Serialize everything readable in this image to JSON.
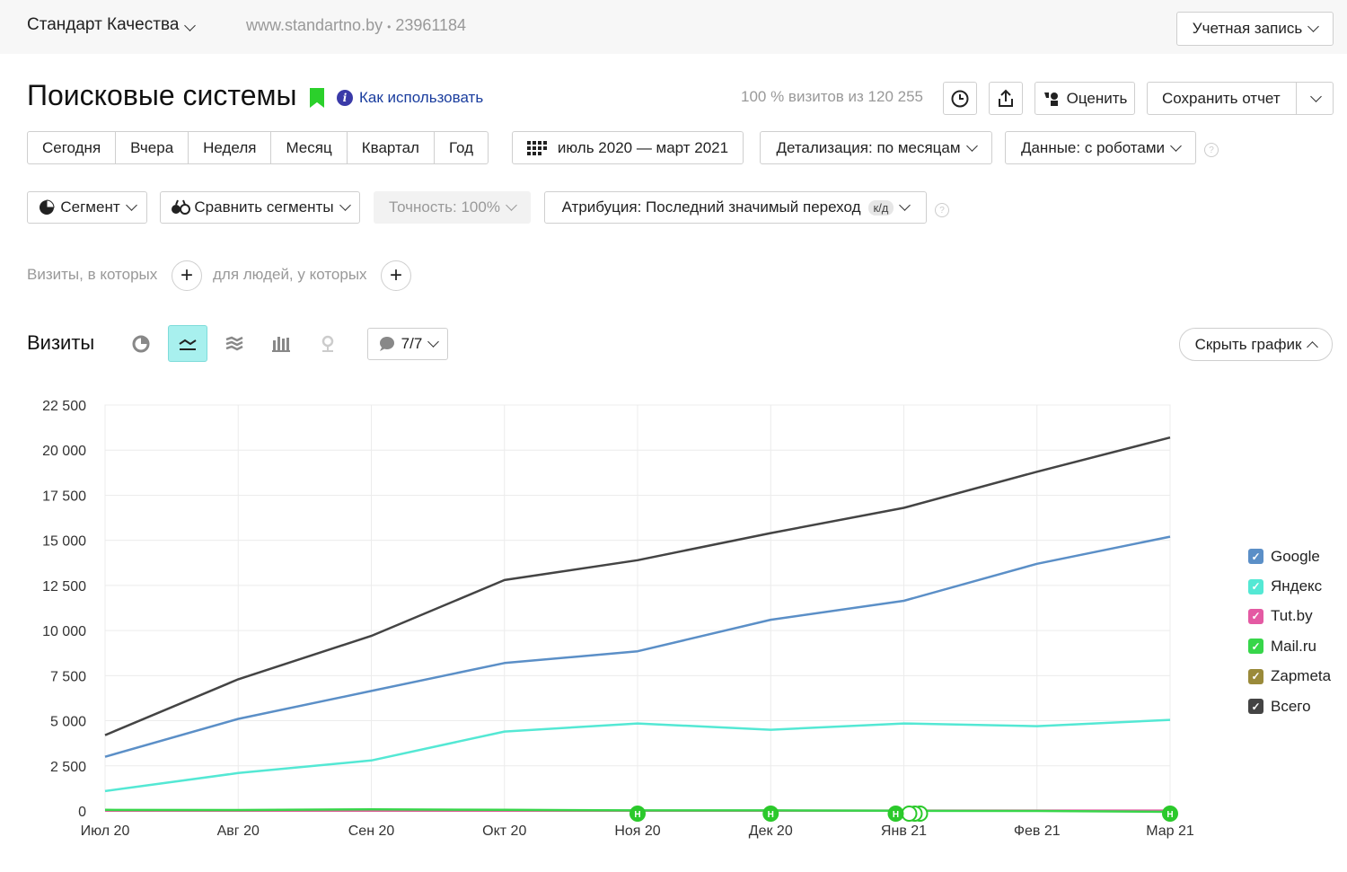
{
  "header": {
    "site_name": "Стандарт Качества",
    "site_url": "www.standartno.by",
    "counter_sep": "•",
    "counter_id": "23961184",
    "account_label": "Учетная запись"
  },
  "report": {
    "title": "Поисковые системы",
    "howto_label": "Как использовать",
    "visits_share": "100 % визитов из 120 255",
    "rate_label": "Оценить",
    "save_label": "Сохранить отчет"
  },
  "periods": [
    "Сегодня",
    "Вчера",
    "Неделя",
    "Месяц",
    "Квартал",
    "Год"
  ],
  "date_range": "июль 2020 — март 2021",
  "detail_label": "Детализация: по месяцам",
  "data_label": "Данные: с роботами",
  "segment_label": "Сегмент",
  "compare_label": "Сравнить сегменты",
  "accuracy_label": "Точность: 100%",
  "attribution_label": "Атрибуция: Последний значимый переход",
  "attribution_badge": "к/д",
  "filters": {
    "visits_label": "Визиты, в которых",
    "people_label": "для людей, у которых"
  },
  "graph_section": {
    "title": "Визиты",
    "series_count": "7/7",
    "hide_label": "Скрыть график"
  },
  "colors": {
    "Google": "#5b8fc7",
    "Яндекс": "#54e8d4",
    "Tut.by": "#e45aa3",
    "Mail.ru": "#37d64a",
    "Zapmeta": "#9a8a3a",
    "Всего": "#444444"
  },
  "chart_data": {
    "type": "line",
    "categories": [
      "Июл 20",
      "Авг 20",
      "Сен 20",
      "Окт 20",
      "Ноя 20",
      "Дек 20",
      "Янв 21",
      "Фев 21",
      "Мар 21"
    ],
    "ylim": [
      0,
      22500
    ],
    "yticks": [
      "0",
      "2 500",
      "5 000",
      "7 500",
      "10 000",
      "12 500",
      "15 000",
      "17 500",
      "20 000",
      "22 500"
    ],
    "grid": true,
    "legend_position": "right",
    "series": [
      {
        "name": "Google",
        "values": [
          3000,
          5100,
          6650,
          8200,
          8850,
          10600,
          11650,
          13700,
          15200
        ]
      },
      {
        "name": "Яндекс",
        "values": [
          1100,
          2100,
          2800,
          4400,
          4850,
          4500,
          4850,
          4700,
          5050
        ]
      },
      {
        "name": "Tut.by",
        "values": [
          20,
          20,
          20,
          20,
          20,
          20,
          20,
          20,
          20
        ]
      },
      {
        "name": "Mail.ru",
        "values": [
          60,
          50,
          90,
          60,
          30,
          30,
          10,
          0,
          -50
        ]
      },
      {
        "name": "Zapmeta",
        "values": [
          10,
          10,
          10,
          10,
          10,
          10,
          10,
          10,
          10
        ]
      },
      {
        "name": "Всего",
        "values": [
          4200,
          7300,
          9700,
          12800,
          13900,
          15400,
          16800,
          18800,
          20700
        ]
      }
    ],
    "annotations": [
      {
        "x": "Ноя 20",
        "label": "Н"
      },
      {
        "x": "Дек 20",
        "label": "Н"
      },
      {
        "x": "Янв 21",
        "label": "Н"
      },
      {
        "x": "Мар 21",
        "label": "Н"
      }
    ]
  }
}
